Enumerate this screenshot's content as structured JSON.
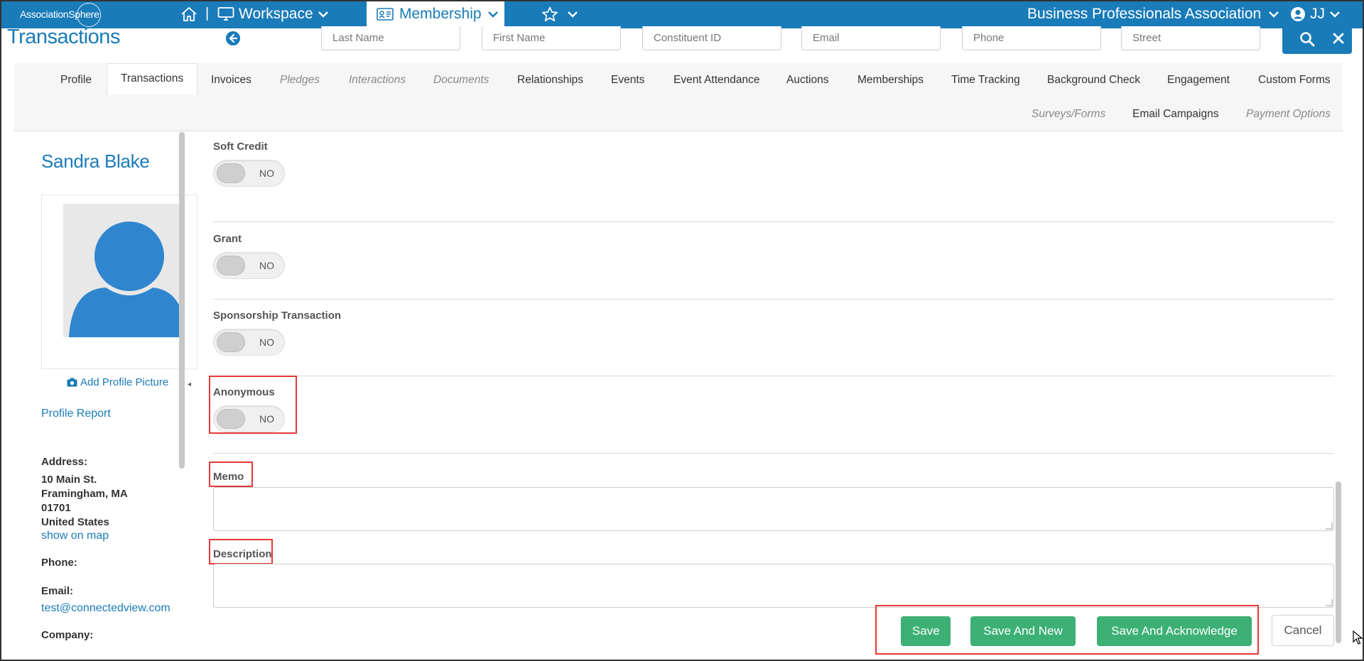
{
  "topbar": {
    "logo_text": "AssociationSphere",
    "home_icon": "home-icon",
    "separator": "|",
    "workspace_label": "Workspace",
    "membership_label": "Membership",
    "favorites_icon": "star-icon",
    "organization": "Business Professionals Association",
    "user_initials": "JJ",
    "colors": {
      "bar": "#1a7bb9",
      "active_tab_bg": "#ffffff"
    }
  },
  "page": {
    "title": "Transactions"
  },
  "search": {
    "last_name_placeholder": "Last Name",
    "first_name_placeholder": "First Name",
    "constituent_id_placeholder": "Constituent ID",
    "email_placeholder": "Email",
    "phone_placeholder": "Phone",
    "street_placeholder": "Street"
  },
  "tabs": {
    "profile": "Profile",
    "transactions": "Transactions",
    "invoices": "Invoices",
    "pledges": "Pledges",
    "interactions": "Interactions",
    "documents": "Documents",
    "relationships": "Relationships",
    "events": "Events",
    "event_attendance": "Event Attendance",
    "auctions": "Auctions",
    "memberships": "Memberships",
    "time_tracking": "Time Tracking",
    "background_check": "Background Check",
    "engagement": "Engagement",
    "custom_forms": "Custom Forms",
    "surveys_forms": "Surveys/Forms",
    "email_campaigns": "Email Campaigns",
    "payment_options": "Payment Options",
    "active": "Transactions"
  },
  "profile": {
    "name": "Sandra Blake",
    "add_picture": "Add Profile Picture",
    "profile_report": "Profile Report",
    "address_label": "Address:",
    "address_line1": "10 Main St.",
    "address_line2": "Framingham, MA",
    "address_line3": "01701",
    "address_line4": "United States",
    "show_on_map": "show on map",
    "phone_label": "Phone:",
    "email_label": "Email:",
    "email_value": "test@connectedview.com",
    "company_label": "Company:"
  },
  "form": {
    "soft_credit_label": "Soft Credit",
    "soft_credit_state": "NO",
    "grant_label": "Grant",
    "grant_state": "NO",
    "sponsorship_label": "Sponsorship Transaction",
    "sponsorship_state": "NO",
    "anonymous_label": "Anonymous",
    "anonymous_state": "NO",
    "memo_label": "Memo",
    "memo_value": "",
    "description_label": "Description",
    "description_value": ""
  },
  "actions": {
    "save": "Save",
    "save_and_new": "Save And New",
    "save_and_acknowledge": "Save And Acknowledge",
    "cancel": "Cancel",
    "colors": {
      "primary": "#3db075",
      "highlight": "#e53935"
    }
  }
}
